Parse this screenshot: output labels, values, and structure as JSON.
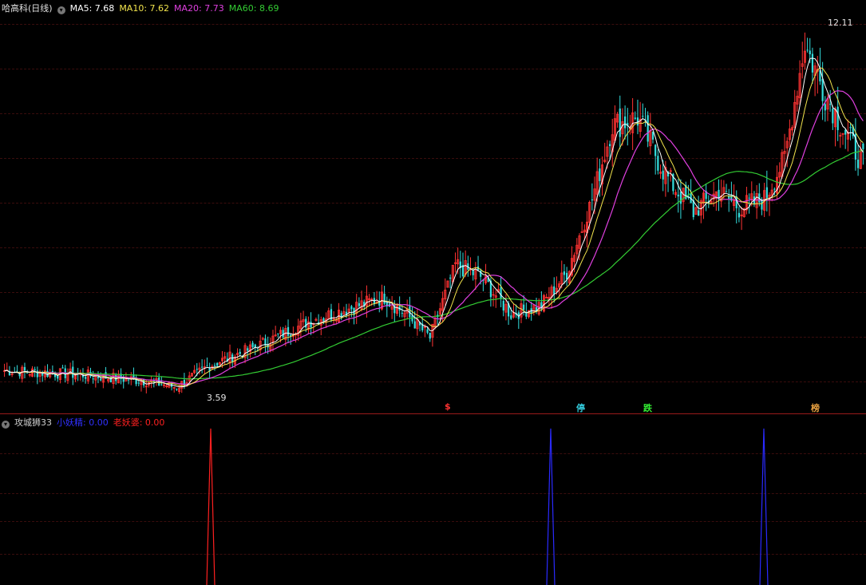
{
  "main": {
    "stock_label": "哈高科(日线)",
    "ma5": "MA5: 7.68",
    "ma10": "MA10: 7.62",
    "ma20": "MA20: 7.73",
    "ma60": "MA60: 8.69",
    "high_label": "12.11",
    "low_label": "3.59",
    "signals": [
      {
        "text": "$",
        "color": "#ff3333"
      },
      {
        "text": "停",
        "color": "#33ccdd"
      },
      {
        "text": "跌",
        "color": "#33ee33"
      },
      {
        "text": "榜",
        "color": "#e8a040"
      }
    ]
  },
  "sub": {
    "name": "攻城狮33",
    "line1": "小妖精: 0.00",
    "line2": "老妖婆: 0.00"
  },
  "colors": {
    "ma5": "#ffffff",
    "ma10": "#f2e44d",
    "ma20": "#e040e0",
    "ma60": "#33cc33",
    "up": "#ff3333",
    "down": "#33dddd",
    "grid": "#3a0d0d",
    "spike_red": "#ff2020",
    "spike_blue": "#2a2aff",
    "label_blue": "#3030ff"
  },
  "chart_data": {
    "type": "candlestick",
    "ma_lines": [
      "MA5",
      "MA10",
      "MA20",
      "MA60"
    ],
    "prices_sample": [
      3.9,
      4.0,
      3.8,
      3.7,
      3.59,
      4.1,
      4.6,
      5.2,
      5.0,
      5.4,
      5.6,
      6.8,
      5.8,
      5.2,
      6.2,
      9.6,
      8.8,
      8.0,
      7.6,
      7.4,
      7.8,
      10.2,
      12.11,
      10.4,
      9.0
    ],
    "sub_spikes": [
      {
        "position": "left",
        "color": "red"
      },
      {
        "position": "middle",
        "color": "blue"
      },
      {
        "position": "right",
        "color": "blue"
      }
    ]
  }
}
